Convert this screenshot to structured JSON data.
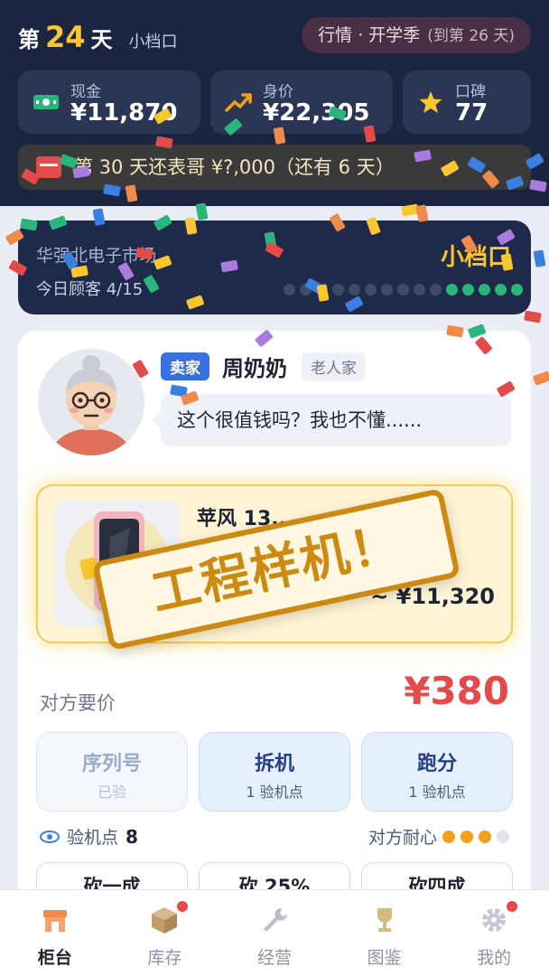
{
  "header": {
    "day_prefix": "第",
    "day_number": "24",
    "day_suffix": "天",
    "shop_level": "小档口",
    "market_event": "行情 · 开学季",
    "market_event_until": "(到第 26 天)",
    "stats": [
      {
        "label": "现金",
        "value": "¥11,870",
        "icon": "cash-icon"
      },
      {
        "label": "身价",
        "value": "¥22,305",
        "icon": "trend-up-icon"
      },
      {
        "label": "口碑",
        "value": "77",
        "icon": "star-icon"
      }
    ],
    "debt_notice": "第 30 天还表哥 ¥?,000（还有 6 天）"
  },
  "location": {
    "name": "华强北电子市场",
    "customers": "今日顾客 4/15",
    "tier": "小档口",
    "customers_served": 4,
    "customers_total": 15
  },
  "customer": {
    "role_badge": "卖家",
    "name": "周奶奶",
    "type": "老人家",
    "speech": "这个很值钱吗？我也不懂......"
  },
  "item": {
    "name": "苹风 13...",
    "price_range": "~ ¥11,320",
    "icon": "phone-icon"
  },
  "stamp_text": "工程样机！",
  "offer": {
    "ask_label": "对方要价",
    "ask_price": "¥380"
  },
  "actions": [
    {
      "title": "序列号",
      "sub": "已验",
      "done": true
    },
    {
      "title": "拆机",
      "sub": "1 验机点",
      "done": false
    },
    {
      "title": "跑分",
      "sub": "1 验机点",
      "done": false
    }
  ],
  "inspection": {
    "label": "验机点",
    "value": "8"
  },
  "patience": {
    "label": "对方耐心",
    "level": 3,
    "max": 4
  },
  "bargain_options": [
    "砍一成",
    "砍 25%",
    "砍四成"
  ],
  "nav": [
    {
      "label": "柜台",
      "icon": "shop-icon",
      "active": true,
      "badge": false
    },
    {
      "label": "库存",
      "icon": "box-icon",
      "active": false,
      "badge": true
    },
    {
      "label": "经营",
      "icon": "wrench-icon",
      "active": false,
      "badge": false
    },
    {
      "label": "图鉴",
      "icon": "trophy-icon",
      "active": false,
      "badge": false
    },
    {
      "label": "我的",
      "icon": "gear-icon",
      "active": false,
      "badge": true
    }
  ],
  "colors": {
    "header_bg": "#1c2540",
    "accent_gold": "#f8c62e",
    "price_red": "#e34a4a",
    "action_blue": "#24408a",
    "stamp": "#cd8a12"
  }
}
